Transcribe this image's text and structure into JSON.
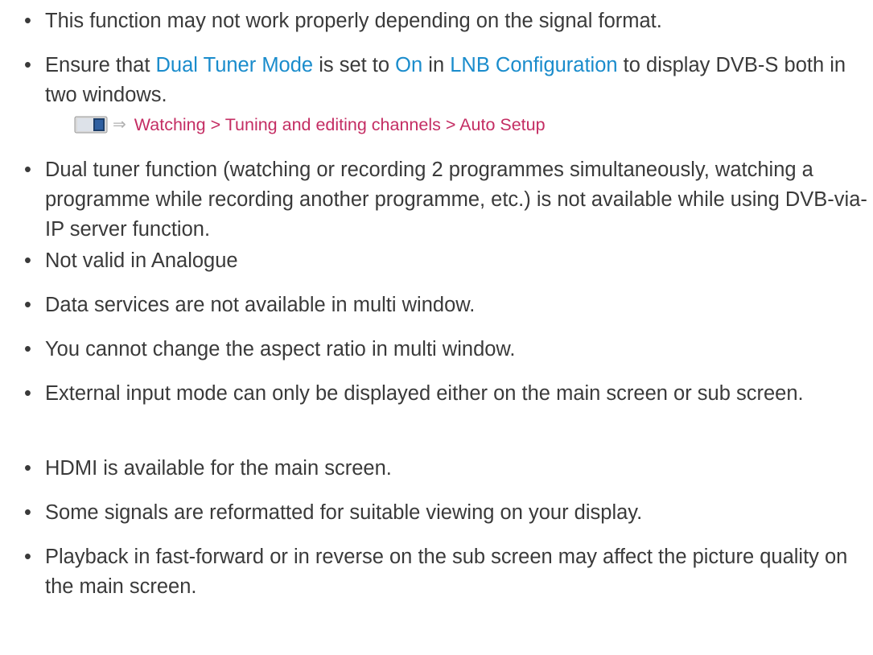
{
  "bullet_glyph": "•",
  "notes": [
    {
      "text": "This function may not work properly depending on the signal format."
    },
    {
      "parts": [
        {
          "t": "Ensure that "
        },
        {
          "t": "Dual Tuner Mode",
          "link": true
        },
        {
          "t": " is set to "
        },
        {
          "t": "On",
          "link": true
        },
        {
          "t": " in "
        },
        {
          "t": "LNB Configuration",
          "link": true
        },
        {
          "t": " to display DVB-S both in two windows."
        }
      ]
    },
    {
      "text": "Dual tuner function (watching or recording 2 programmes simultaneously, watching a programme while recording another programme, etc.) is not available while using DVB-via-IP server function."
    },
    {
      "text": "Not valid in Analogue"
    },
    {
      "text": "Data services are not available in multi window."
    },
    {
      "text": "You cannot change the aspect ratio in multi window."
    },
    {
      "text": "External input mode can only be displayed either on the main screen or sub screen."
    },
    {
      "text": "HDMI is available for the main screen."
    },
    {
      "text": "Some signals are reformatted for suitable viewing on your display."
    },
    {
      "text": "Playback in fast-forward or in reverse on the sub screen may affect the picture quality on the main screen."
    }
  ],
  "reference": {
    "icon": "tv-manual-icon",
    "arrow_icon": "arrow-right-icon",
    "arrow_glyph": "⇒",
    "path": "Watching > Tuning and editing channels > Auto Setup"
  },
  "colors": {
    "body_text": "#3a3a3a",
    "link": "#1a8ccc",
    "reference_link": "#c42d63"
  }
}
